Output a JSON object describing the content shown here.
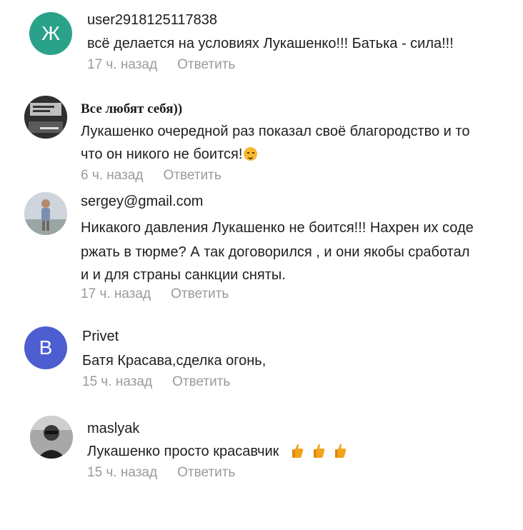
{
  "comments": [
    {
      "avatar_letter": "Ж",
      "avatar_color": "#2aa28a",
      "username": "user2918125117838",
      "lines": [
        "всё делается на условиях Лукашенко!!! Батька - сила!!!"
      ],
      "time": "17 ч. назад",
      "reply": "Ответить"
    },
    {
      "avatar_icon": "photo-avatar",
      "username": "Все любят себя))",
      "lines": [
        "Лукашенко очередной раз показал своё благородство и то",
        "что он никого не боится!"
      ],
      "emoji": "blush-face-icon",
      "time": "6 ч. назад",
      "reply": "Ответить"
    },
    {
      "avatar_icon": "photo-avatar",
      "username": "sergey@gmail.com",
      "lines": [
        "Никакого давления Лукашенко не боится!!! Нахрен их соде",
        "ржать в тюрме? А так договорился , и они якобы сработал",
        "и и для страны санкции сняты."
      ],
      "time": "17 ч. назад",
      "reply": "Ответить"
    },
    {
      "avatar_letter": "В",
      "avatar_color": "#4d5ed1",
      "username": "Privet",
      "lines": [
        "Батя Красава,сделка огонь,"
      ],
      "time": "15 ч. назад",
      "reply": "Ответить"
    },
    {
      "avatar_icon": "photo-avatar",
      "username": "maslyak",
      "lines": [
        "Лукашенко просто красавчик"
      ],
      "emoji": "thumbs-up-icon",
      "time": "15 ч. назад",
      "reply": "Ответить"
    }
  ]
}
